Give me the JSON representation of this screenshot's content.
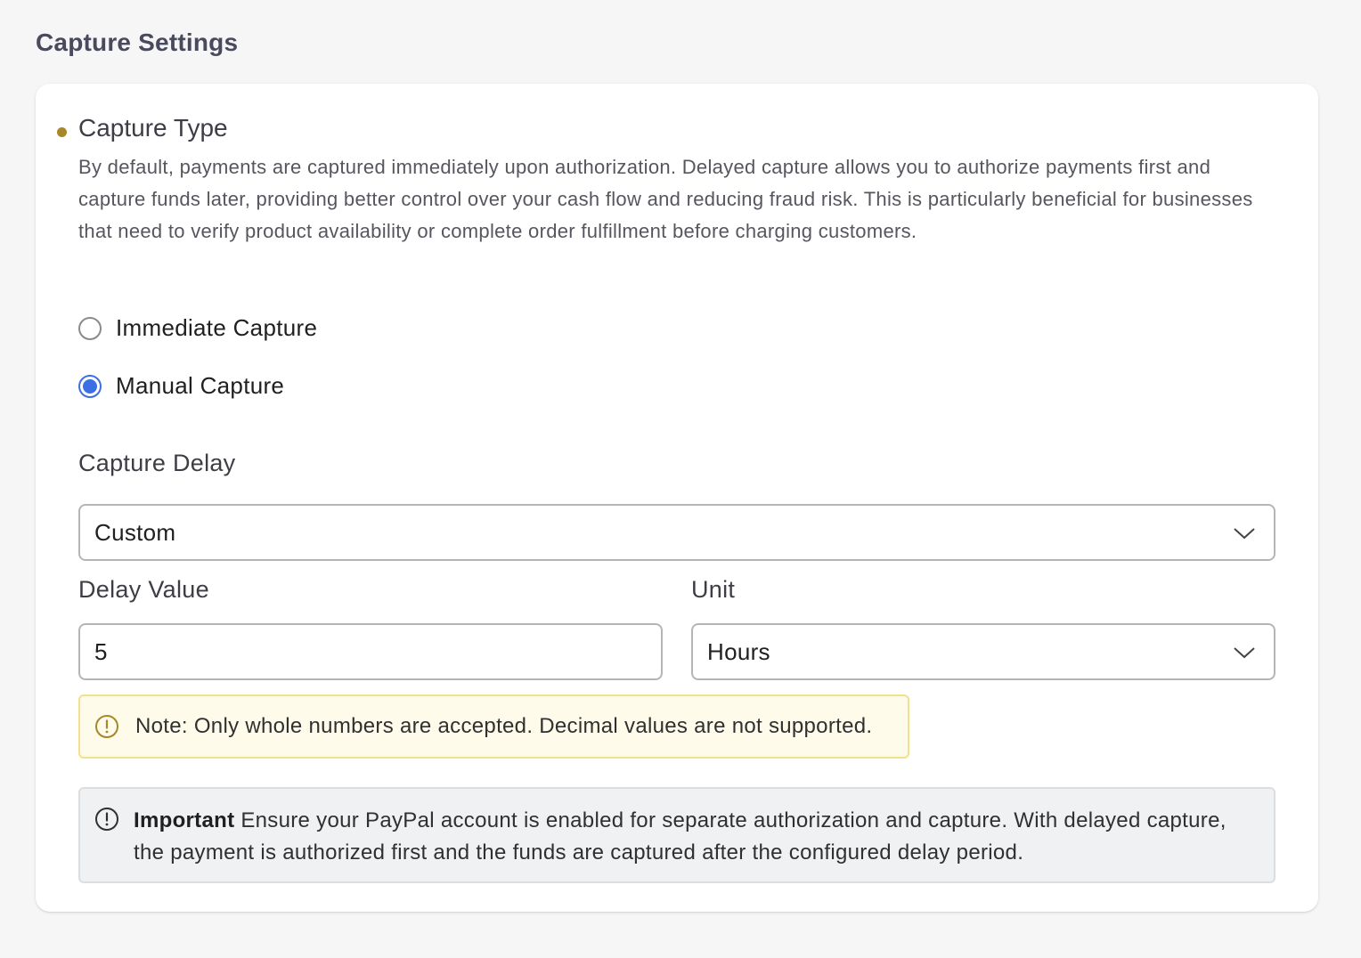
{
  "page": {
    "heading": "Capture Settings"
  },
  "capture_type": {
    "title": "Capture Type",
    "description": "By default, payments are captured immediately upon authorization. Delayed capture allows you to authorize payments first and capture funds later, providing better control over your cash flow and reducing fraud risk. This is particularly beneficial for businesses that need to verify product availability or complete order fulfillment before charging customers.",
    "options": [
      {
        "label": "Immediate Capture",
        "selected": false
      },
      {
        "label": "Manual Capture",
        "selected": true
      }
    ]
  },
  "capture_delay": {
    "label": "Capture Delay",
    "selected": "Custom"
  },
  "delay_value": {
    "label": "Delay Value",
    "value": "5"
  },
  "unit": {
    "label": "Unit",
    "selected": "Hours"
  },
  "note": {
    "text": "Note: Only whole numbers are accepted. Decimal values are not supported.",
    "icon": "alert-circle-icon",
    "color": "#a8872a"
  },
  "important": {
    "heading": "Important",
    "text": "Ensure your PayPal account is enabled for separate authorization and capture. With delayed capture, the payment is authorized first and the funds are captured after the configured delay period.",
    "icon": "info-circle-icon"
  },
  "colors": {
    "accent": "#3b6fe3",
    "dot": "#a8872a",
    "note_bg": "#fefbea",
    "note_border": "#f3e08a"
  }
}
